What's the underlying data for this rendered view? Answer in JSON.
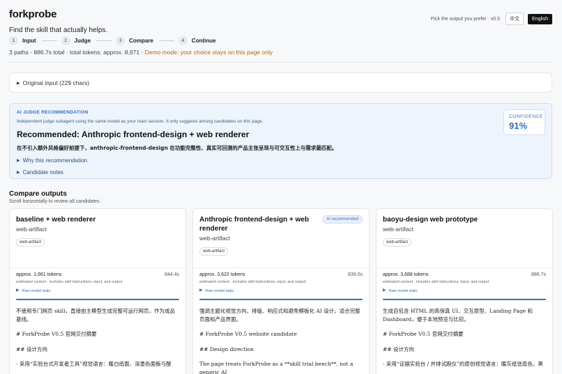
{
  "app": {
    "name": "forkprobe",
    "tagline": "Find the skill that actually helps."
  },
  "topbar": {
    "hint": "Pick the output you prefer · v0.5",
    "lang_zh": "中文",
    "lang_en": "English"
  },
  "steps": [
    {
      "num": "1",
      "label": "Input"
    },
    {
      "num": "2",
      "label": "Judge"
    },
    {
      "num": "3",
      "label": "Compare"
    },
    {
      "num": "4",
      "label": "Continue"
    }
  ],
  "meta": {
    "summary": "3 paths · 886.7s total · total tokens: approx. 8,971 · ",
    "demo": "Demo mode: your choice stays on this page only"
  },
  "original_input": {
    "label": "Original input (229 chars)"
  },
  "judge": {
    "eyebrow": "AI JUDGE RECOMMENDATION",
    "subtitle": "Independent judge subagent using the same model as your main session. It only suggests among candidates on this page.",
    "recommendation": "Recommended: Anthropic frontend-design + web renderer",
    "reason": "在不引入额外风格偏好前提下，anthropic-frontend-design 在功能完整性、真实可回测的产品主张呈现与可交互性上与需求最匹配。",
    "why_label": "Why this recommendation",
    "notes_label": "Candidate notes",
    "confidence_label": "CONFIDENCE",
    "confidence_value": "91%"
  },
  "compare": {
    "title": "Compare outputs",
    "subtitle": "Scroll horizontally to review all candidates."
  },
  "cards": [
    {
      "title": "baseline + web renderer",
      "type": "web-artifact",
      "tag": "web-artifact",
      "badge": "",
      "tokens": "approx. 1,661 tokens",
      "time": "844.4s",
      "est": "estimated context · includes skill instructions, input, and output",
      "raw": "Raw model stats",
      "lines": [
        "不使用专门网页 skill，直接由主模型生成完整可运行网页，作为成品基线。",
        "# ForkProbe V0.5 官网交付摘要",
        "## 设计方向",
        "- 采用“实验台式开发者工具”视觉语言：暖白纸面、深墨色面板与酸"
      ]
    },
    {
      "title": "Anthropic frontend-design + web renderer",
      "type": "web-artifact",
      "tag": "web-artifact",
      "badge": "AI recommended",
      "tokens": "approx. 3,622 tokens",
      "time": "839.0s",
      "est": "estimated context · includes skill instructions, input, and output",
      "raw": "Raw model stats",
      "lines": [
        "强调主题化视觉方向、排版、响应式和避免模板化 AI 设计，适合完整页面和产品界面。",
        "# ForkProbe V0.5 website candidate",
        "## Design direction",
        "The page treats ForkProbe as a **skill trial bench**, not a generic AI"
      ]
    },
    {
      "title": "baoyu-design web prototype",
      "type": "web-artifact",
      "tag": "web-artifact",
      "badge": "",
      "tokens": "approx. 3,688 tokens",
      "time": "886.7s",
      "est": "estimated context · includes skill instructions, input, and output",
      "raw": "Raw model stats",
      "lines": [
        "生成自包含 HTML 的高保真 UI、交互原型、Landing Page 和 Dashboard，便于本地预览与比较。",
        "# ForkProbe V0.5 官网交付摘要",
        "## 设计方向",
        "- 采用“证据实验台 / 并排试跑仪”的原创视觉语言：暖灰纸张底色、黑"
      ]
    }
  ]
}
